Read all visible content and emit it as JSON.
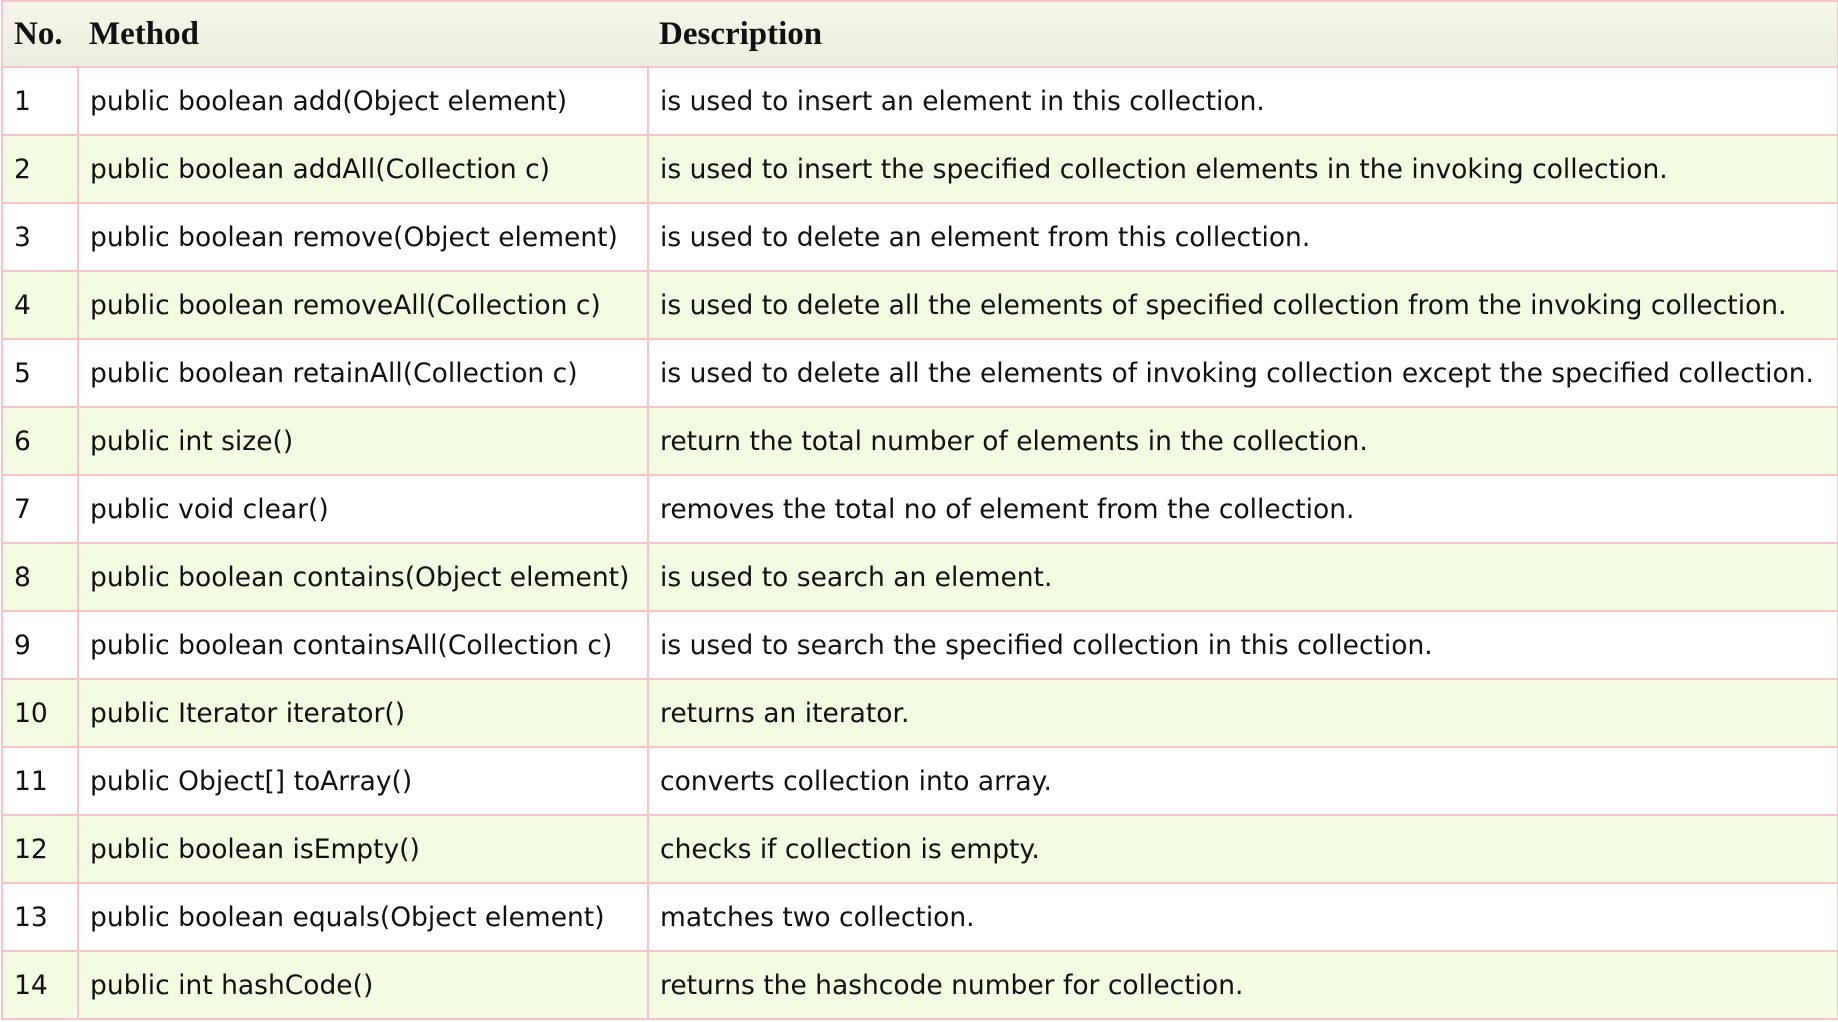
{
  "table": {
    "headers": {
      "no": "No.",
      "method": "Method",
      "description": "Description"
    },
    "rows": [
      {
        "no": "1",
        "method": "public boolean add(Object element)",
        "description": "is used to insert an element in this collection."
      },
      {
        "no": "2",
        "method": "public boolean addAll(Collection c)",
        "description": "is used to insert the specified collection elements in the invoking collection."
      },
      {
        "no": "3",
        "method": "public boolean remove(Object element)",
        "description": "is used to delete an element from this collection."
      },
      {
        "no": "4",
        "method": "public boolean removeAll(Collection c)",
        "description": "is used to delete all the elements of specified collection from the invoking collection."
      },
      {
        "no": "5",
        "method": "public boolean retainAll(Collection c)",
        "description": "is used to delete all the elements of invoking collection except the specified collection."
      },
      {
        "no": "6",
        "method": "public int size()",
        "description": "return the total number of elements in the collection."
      },
      {
        "no": "7",
        "method": "public void clear()",
        "description": "removes the total no of element from the collection."
      },
      {
        "no": "8",
        "method": "public boolean contains(Object element)",
        "description": "is used to search an element."
      },
      {
        "no": "9",
        "method": "public boolean containsAll(Collection c)",
        "description": "is used to search the specified collection in this collection."
      },
      {
        "no": "10",
        "method": "public Iterator iterator()",
        "description": "returns an iterator."
      },
      {
        "no": "11",
        "method": "public Object[] toArray()",
        "description": "converts collection into array."
      },
      {
        "no": "12",
        "method": "public boolean isEmpty()",
        "description": "checks if collection is empty."
      },
      {
        "no": "13",
        "method": "public boolean equals(Object element)",
        "description": "matches two collection."
      },
      {
        "no": "14",
        "method": "public int hashCode()",
        "description": "returns the hashcode number for collection."
      }
    ]
  },
  "colors": {
    "border": "#f4c6cc",
    "header_bg_top": "#f6f6e8",
    "header_bg_bottom": "#e9eede",
    "row_even_bg": "#f3fbe3",
    "row_odd_bg": "#ffffff",
    "text": "#111111"
  }
}
